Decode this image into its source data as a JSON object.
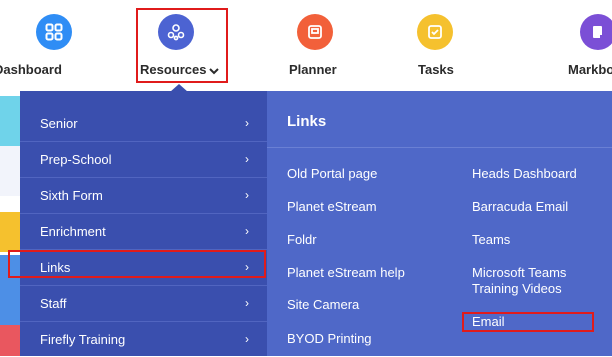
{
  "topnav": {
    "items": [
      {
        "label": "Dashboard",
        "icon": "grid-icon",
        "color": "#2f8df5"
      },
      {
        "label": "Resources",
        "icon": "resources-icon",
        "color": "#4c63d2"
      },
      {
        "label": "Planner",
        "icon": "planner-icon",
        "color": "#f2603a"
      },
      {
        "label": "Tasks",
        "icon": "tasks-icon",
        "color": "#f5c12e"
      },
      {
        "label": "Markbook",
        "icon": "markbook-icon",
        "color": "#7b4fd6"
      }
    ]
  },
  "menu": {
    "items": [
      {
        "label": "Senior"
      },
      {
        "label": "Prep-School"
      },
      {
        "label": "Sixth Form"
      },
      {
        "label": "Enrichment"
      },
      {
        "label": "Links"
      },
      {
        "label": "Staff"
      },
      {
        "label": "Firefly Training"
      }
    ]
  },
  "panel": {
    "title": "Links",
    "links_col1": [
      "Old Portal page",
      "Planet eStream",
      "Foldr",
      "Planet eStream help",
      "Site Camera",
      "BYOD Printing"
    ],
    "links_col2": [
      "Heads Dashboard",
      "Barracuda Email",
      "Teams",
      "Microsoft Teams Training Videos",
      "Email"
    ]
  },
  "colors": {
    "highlight": "#e01b1b",
    "menu_bg": "#3a4fae",
    "panel_bg": "#4f68c8"
  }
}
